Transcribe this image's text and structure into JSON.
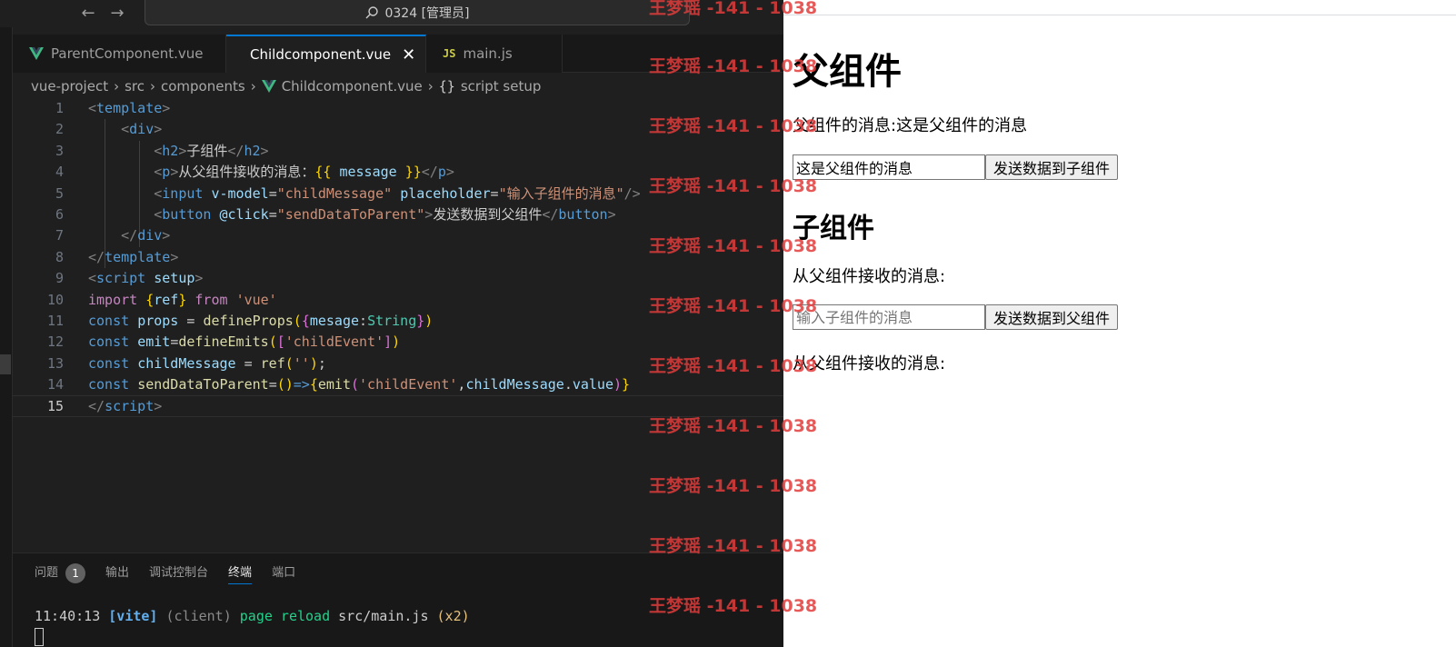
{
  "editor": {
    "command_center": "0324 [管理员]",
    "tabs": [
      {
        "label": "ParentComponent.vue",
        "icon": "vue-icon",
        "active": false
      },
      {
        "label": "Childcomponent.vue",
        "icon": "vue-icon",
        "active": true
      },
      {
        "label": "main.js",
        "icon": "js-icon",
        "active": false
      }
    ],
    "js_icon_text": "JS",
    "close_glyph": "✕",
    "breadcrumb": [
      "vue-project",
      "src",
      "components",
      "Childcomponent.vue",
      "script setup"
    ],
    "breadcrumb_brace": "{}",
    "line_numbers": [
      "1",
      "2",
      "3",
      "4",
      "5",
      "6",
      "7",
      "8",
      "9",
      "10",
      "11",
      "12",
      "13",
      "14",
      "15"
    ],
    "current_line": 15
  },
  "panel": {
    "tabs": [
      "问题",
      "输出",
      "调试控制台",
      "终端",
      "端口"
    ],
    "problems_count": "1",
    "active_tab": "终端",
    "terminal": {
      "time": "11:40:13",
      "tag": "[vite]",
      "client": "(client)",
      "message": "page reload",
      "path": "src/main.js",
      "count": "(x2)"
    }
  },
  "browser": {
    "parent_title": "父组件",
    "parent_message_line": "父组件的消息:这是父组件的消息",
    "parent_input_value": "这是父组件的消息",
    "parent_button": "发送数据到子组件",
    "child_title": "子组件",
    "child_received_label": "从父组件接收的消息:",
    "child_input_placeholder": "输入子组件的消息",
    "child_button": "发送数据到父组件",
    "received_label_2": "从父组件接收的消息:"
  },
  "watermark": {
    "text": "王梦瑶 -141 - 1038",
    "color": "#e03c3c"
  },
  "colors": {
    "editor_bg": "#1f1f1f",
    "accent": "#0078d4",
    "vue_green": "#41b883"
  }
}
